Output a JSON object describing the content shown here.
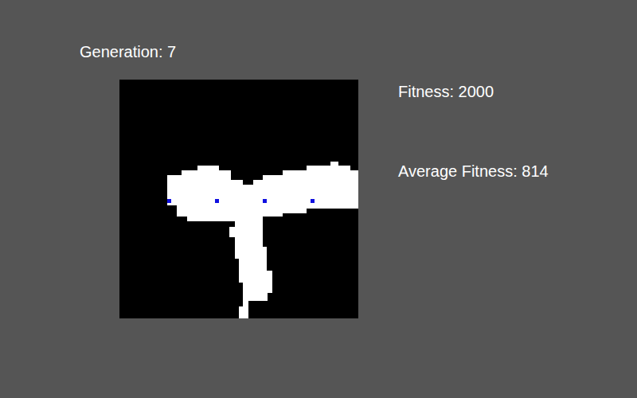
{
  "generation": "Generation: 7",
  "fitness": "Fitness: 2000",
  "average_fitness": "Average Fitness: 814"
}
